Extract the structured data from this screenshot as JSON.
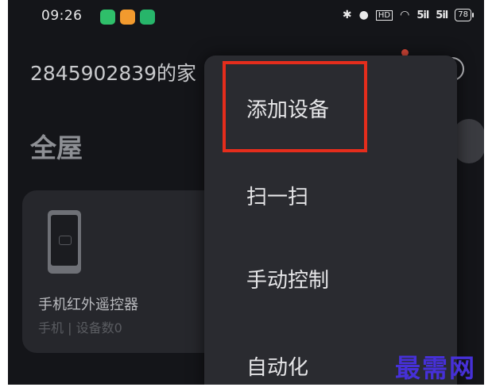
{
  "status_bar": {
    "time": "09:26",
    "notification_colors": [
      "#2fbf6a",
      "#f29a2e",
      "#27b56a"
    ],
    "net_badge": "HD",
    "signal1": "5il",
    "signal2": "5il",
    "battery": "78"
  },
  "home": {
    "title": "2845902839的家",
    "room": "全屋"
  },
  "device": {
    "name": "手机红外遥控器",
    "sub": "手机 | 设备数0"
  },
  "menu": {
    "items": [
      "添加设备",
      "扫一扫",
      "手动控制",
      "自动化"
    ]
  },
  "watermark": "最需网",
  "colors": {
    "highlight": "#e52d1c",
    "watermark": "#4630d8",
    "background": "#141519"
  }
}
